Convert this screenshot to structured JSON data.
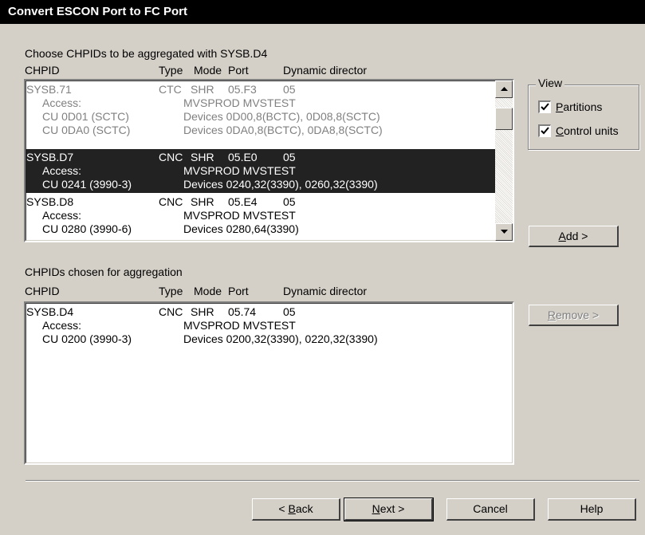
{
  "window": {
    "title": "Convert ESCON Port to FC Port"
  },
  "top_section": {
    "label": "Choose CHPIDs to be aggregated with  SYSB.D4",
    "headers": {
      "chpid": "CHPID",
      "type": "Type",
      "mode": "Mode",
      "port": "Port",
      "dyn": "Dynamic director"
    },
    "entries": [
      {
        "state": "disabled",
        "chpid": "SYSB.71",
        "type": "CTC",
        "mode": "SHR",
        "port": "05.F3",
        "dyn": "05",
        "access_label": "Access:",
        "access": "MVSPROD MVSTEST",
        "cu_lines": [
          {
            "cu": "CU 0D01 (SCTC)",
            "devices": "Devices 0D00,8(BCTC), 0D08,8(SCTC)"
          },
          {
            "cu": "CU 0DA0 (SCTC)",
            "devices": "Devices 0DA0,8(BCTC), 0DA8,8(SCTC)"
          }
        ]
      },
      {
        "state": "selected",
        "chpid": "SYSB.D7",
        "type": "CNC",
        "mode": "SHR",
        "port": "05.E0",
        "dyn": "05",
        "access_label": "Access:",
        "access": "MVSPROD MVSTEST",
        "cu_lines": [
          {
            "cu": "CU 0241 (3990-3)",
            "devices": "Devices 0240,32(3390), 0260,32(3390)"
          }
        ]
      },
      {
        "state": "normal",
        "chpid": "SYSB.D8",
        "type": "CNC",
        "mode": "SHR",
        "port": "05.E4",
        "dyn": "05",
        "access_label": "Access:",
        "access": "MVSPROD MVSTEST",
        "cu_lines": [
          {
            "cu": "CU 0280 (3990-6)",
            "devices": "Devices 0280,64(3390)"
          }
        ]
      }
    ]
  },
  "view": {
    "label": "View",
    "partitions": {
      "label_pre": "",
      "label_accel": "P",
      "label_post": "artitions",
      "checked": true
    },
    "control_units": {
      "label_pre": "",
      "label_accel": "C",
      "label_post": "ontrol units",
      "checked": true
    }
  },
  "bottom_section": {
    "label": "CHPIDs chosen for aggregation",
    "headers": {
      "chpid": "CHPID",
      "type": "Type",
      "mode": "Mode",
      "port": "Port",
      "dyn": "Dynamic director"
    },
    "entries": [
      {
        "chpid": "SYSB.D4",
        "type": "CNC",
        "mode": "SHR",
        "port": "05.74",
        "dyn": "05",
        "access_label": "Access:",
        "access": "MVSPROD MVSTEST",
        "cu": "CU 0200 (3990-3)",
        "devices": "Devices 0200,32(3390), 0220,32(3390)"
      }
    ]
  },
  "buttons": {
    "add": {
      "accel": "A",
      "rest": "dd >"
    },
    "remove": {
      "accel": "R",
      "rest": "emove >"
    },
    "back": {
      "pre": "< ",
      "accel": "B",
      "rest": "ack"
    },
    "next": {
      "accel": "N",
      "rest": "ext >"
    },
    "cancel": "Cancel",
    "help": "Help"
  },
  "icons": {
    "scroll_up": "triangle-up-icon",
    "scroll_down": "triangle-down-icon",
    "check": "checkmark-icon"
  }
}
